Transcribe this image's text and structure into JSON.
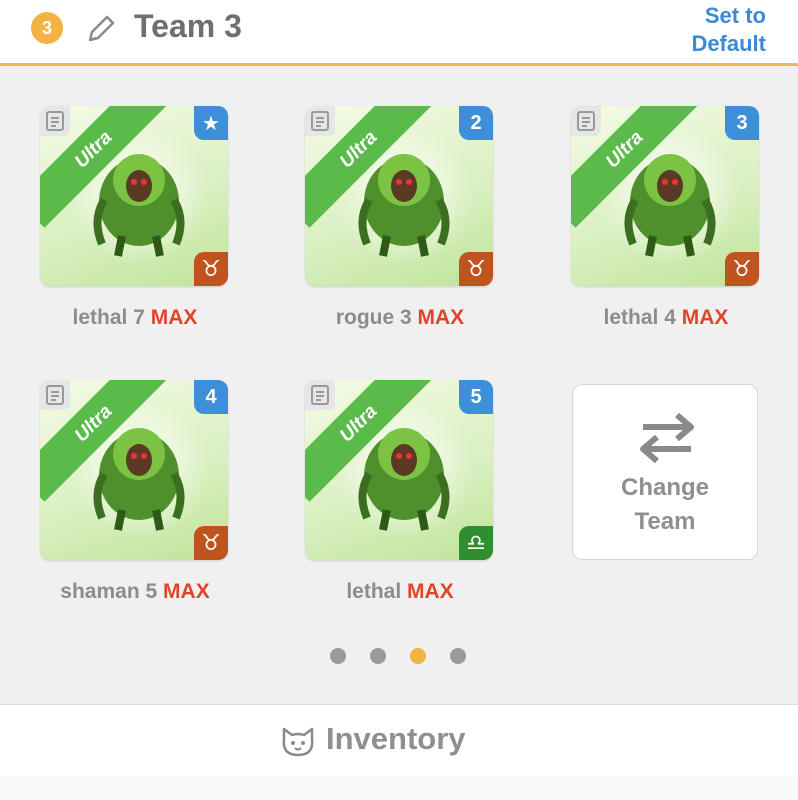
{
  "header": {
    "team_number": "3",
    "team_name": "Team 3",
    "set_default_line1": "Set to",
    "set_default_line2": "Default",
    "icons": {
      "edit": "pencil-icon"
    }
  },
  "cards": [
    {
      "rarity": "Ultra",
      "slot": "★",
      "zodiac": "♉",
      "zodiac_name": "taurus",
      "name": "lethal 7",
      "max": "MAX"
    },
    {
      "rarity": "Ultra",
      "slot": "2",
      "zodiac": "♉",
      "zodiac_name": "taurus",
      "name": "rogue 3",
      "max": "MAX"
    },
    {
      "rarity": "Ultra",
      "slot": "3",
      "zodiac": "♉",
      "zodiac_name": "taurus",
      "name": "lethal 4",
      "max": "MAX"
    },
    {
      "rarity": "Ultra",
      "slot": "4",
      "zodiac": "♉",
      "zodiac_name": "taurus",
      "name": "shaman 5",
      "max": "MAX"
    },
    {
      "rarity": "Ultra",
      "slot": "5",
      "zodiac": "♎",
      "zodiac_name": "libra",
      "name": "lethal",
      "max": "MAX"
    }
  ],
  "change_team": {
    "line1": "Change",
    "line2": "Team",
    "icon": "swap-arrows-icon"
  },
  "pagination": {
    "pages": 4,
    "active_index": 2
  },
  "inventory": {
    "label": "Inventory",
    "icon": "cat-face-icon"
  },
  "colors": {
    "accent": "#f2b340",
    "link": "#3a8ad4",
    "max": "#e0452a",
    "slot_blue": "#3e8fd9",
    "taurus": "#c0541e",
    "libra": "#2f8f2f",
    "ribbon": "#5bbb4a"
  }
}
